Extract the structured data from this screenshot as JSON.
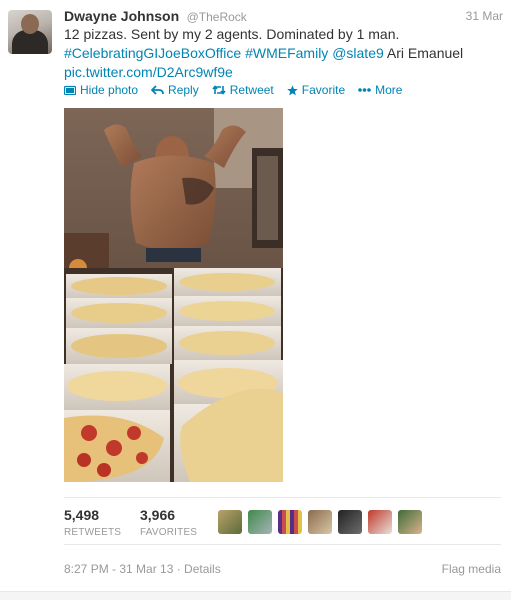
{
  "tweet": {
    "fullname": "Dwayne Johnson",
    "username": "@TheRock",
    "date": "31 Mar",
    "text_line1": "12 pizzas. Sent by my 2 agents. Dominated by 1 man.",
    "hashtag1": "#CelebratingGIJoeBoxOffice",
    "hashtag2": "#WMEFamily",
    "mention": "@slate9",
    "text_tail": "Ari Emanuel",
    "pic_link": "pic.twitter.com/D2Arc9wf9e"
  },
  "actions": {
    "hide_photo": "Hide photo",
    "reply": "Reply",
    "retweet": "Retweet",
    "favorite": "Favorite",
    "more": "More"
  },
  "icons": {
    "hide_photo": "photo-icon",
    "reply": "reply-arrow-icon",
    "retweet": "retweet-icon",
    "favorite": "star-icon",
    "more": "ellipsis-icon"
  },
  "stats": {
    "retweets_count": "5,498",
    "retweets_label": "RETWEETS",
    "favorites_count": "3,966",
    "favorites_label": "FAVORITES"
  },
  "footer": {
    "timestamp": "8:27 PM - 31 Mar 13 · Details",
    "flag_media": "Flag media"
  },
  "colors": {
    "link": "#0084b4",
    "muted": "#999999",
    "text": "#333333"
  }
}
